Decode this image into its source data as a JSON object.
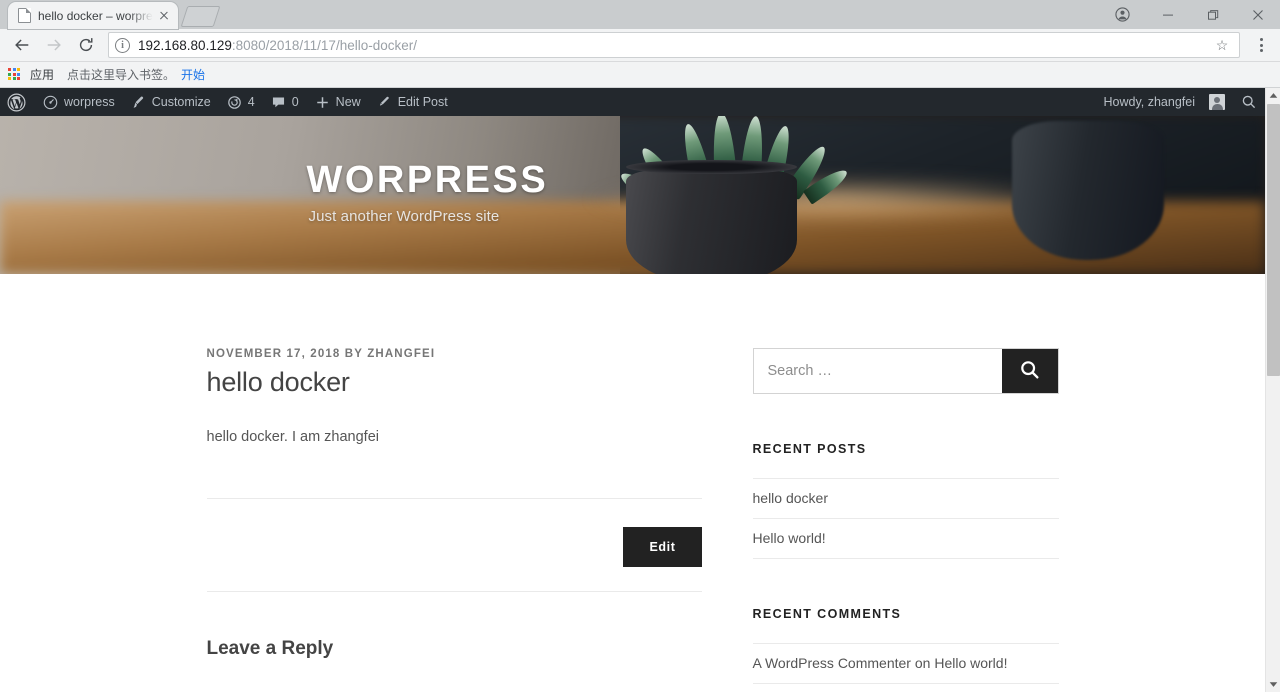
{
  "browser": {
    "tab": {
      "title": "hello docker – worpress",
      "favicon": "page-icon",
      "close": "✕"
    },
    "newtab_label": "+",
    "window_controls": [
      {
        "name": "profile-button",
        "glyph": "⊖"
      },
      {
        "name": "minimize-button",
        "glyph": "−"
      },
      {
        "name": "maximize-button",
        "glyph": "❐"
      },
      {
        "name": "close-button",
        "glyph": "✕"
      }
    ],
    "nav": {
      "back": "←",
      "forward": "→",
      "reload": "⟳"
    },
    "omnibox": {
      "info_glyph": "i",
      "url_host": "192.168.80.129",
      "url_rest": ":8080/2018/11/17/hello-docker/",
      "star": "☆"
    },
    "bookmarks": {
      "apps_label": "应用",
      "import_hint": "点击这里导入书签。",
      "import_link": "开始"
    }
  },
  "adminbar": {
    "wp_logo": "wordpress-logo-icon",
    "site_name": "worpress",
    "customize": "Customize",
    "updates_count": "4",
    "comments_count": "0",
    "new": "New",
    "edit_post": "Edit Post",
    "howdy": "Howdy, zhangfei",
    "search_icon": "search-icon",
    "bg_color": "#23282d"
  },
  "header": {
    "site_title": "WORPRESS",
    "site_description": "Just another WordPress site"
  },
  "post": {
    "meta": "NOVEMBER 17, 2018 BY ZHANGFEI",
    "title": "hello docker",
    "body": "hello docker. I am zhangfei",
    "edit_label": "Edit",
    "comments_heading": "Leave a Reply"
  },
  "sidebar": {
    "search": {
      "placeholder": "Search …",
      "value": "",
      "button_icon": "search-icon"
    },
    "recent_posts": {
      "title": "Recent Posts",
      "items": [
        {
          "label": "hello docker"
        },
        {
          "label": "Hello world!"
        }
      ]
    },
    "recent_comments": {
      "title": "Recent Comments",
      "items": [
        {
          "author": "A WordPress Commenter",
          "connector": " on ",
          "post": "Hello world!"
        }
      ]
    }
  },
  "colors": {
    "admin_bar": "#23282d",
    "button_dark": "#222222",
    "link_blue": "#1a73e8",
    "meta_gray": "#767676"
  }
}
